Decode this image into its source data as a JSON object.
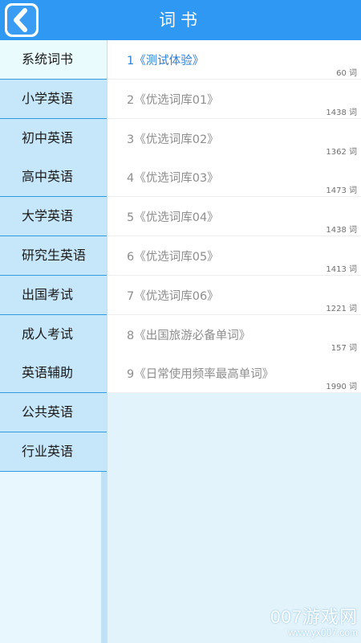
{
  "header": {
    "title": "词书",
    "back_icon": "chevron-left-icon"
  },
  "sidebar": {
    "items": [
      {
        "label": "系统词书",
        "active": true
      },
      {
        "label": "小学英语",
        "active": false
      },
      {
        "label": "初中英语",
        "active": false
      },
      {
        "label": "高中英语",
        "active": false
      },
      {
        "label": "大学英语",
        "active": false
      },
      {
        "label": "研究生英语",
        "active": false
      },
      {
        "label": "出国考试",
        "active": false
      },
      {
        "label": "成人考试",
        "active": false
      },
      {
        "label": "英语辅助",
        "active": false
      },
      {
        "label": "公共英语",
        "active": false
      },
      {
        "label": "行业英语",
        "active": false
      }
    ]
  },
  "books": [
    {
      "name": "1《测试体验》",
      "count": "60 词",
      "active": true
    },
    {
      "name": "2《优选词库01》",
      "count": "1438 词",
      "active": false
    },
    {
      "name": "3《优选词库02》",
      "count": "1362 词",
      "active": false
    },
    {
      "name": "4《优选词库03》",
      "count": "1473 词",
      "active": false
    },
    {
      "name": "5《优选词库04》",
      "count": "1438 词",
      "active": false
    },
    {
      "name": "6《优选词库05》",
      "count": "1413 词",
      "active": false
    },
    {
      "name": "7《优选词库06》",
      "count": "1221 词",
      "active": false
    },
    {
      "name": "8《出国旅游必备单词》",
      "count": "157 词",
      "active": false
    },
    {
      "name": "9《日常使用频率最高单词》",
      "count": "1990 词",
      "active": false
    }
  ],
  "watermark": {
    "line1": "007游戏网",
    "line2": "www.yx007.com"
  },
  "colors": {
    "header": "#2e98f2",
    "active_text": "#2d7fd6",
    "sidebar_item": "#c6e6fa",
    "sidebar_active": "#e9fbfc"
  }
}
